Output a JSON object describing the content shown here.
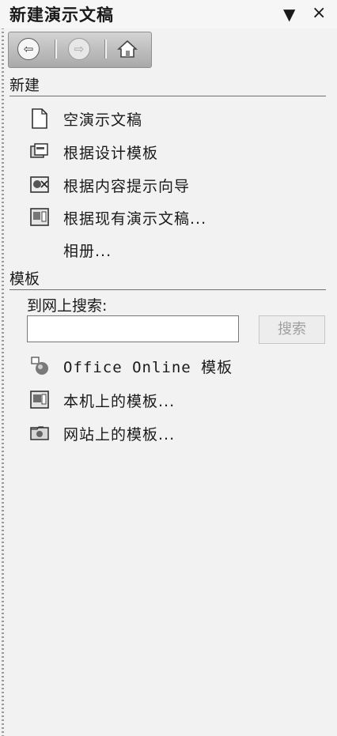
{
  "panel": {
    "title": "新建演示文稿",
    "menu_icon": "▼",
    "close_icon": "×"
  },
  "nav": {
    "back_glyph": "⇦",
    "forward_glyph": "⇨"
  },
  "new_section": {
    "title": "新建",
    "items": [
      {
        "label": "空演示文稿",
        "icon": "blank-document-icon"
      },
      {
        "label": "根据设计模板",
        "icon": "design-template-icon"
      },
      {
        "label": "根据内容提示向导",
        "icon": "content-wizard-icon"
      },
      {
        "label": "根据现有演示文稿...",
        "icon": "existing-presentation-icon"
      },
      {
        "label": "相册...",
        "icon": ""
      }
    ]
  },
  "template_section": {
    "title": "模板",
    "search_label": "到网上搜索:",
    "search_value": "",
    "search_button": "搜索",
    "items": [
      {
        "label": "Office Online 模板",
        "icon": "office-online-icon"
      },
      {
        "label": "本机上的模板...",
        "icon": "local-templates-icon"
      },
      {
        "label": "网站上的模板...",
        "icon": "website-templates-icon"
      }
    ]
  }
}
